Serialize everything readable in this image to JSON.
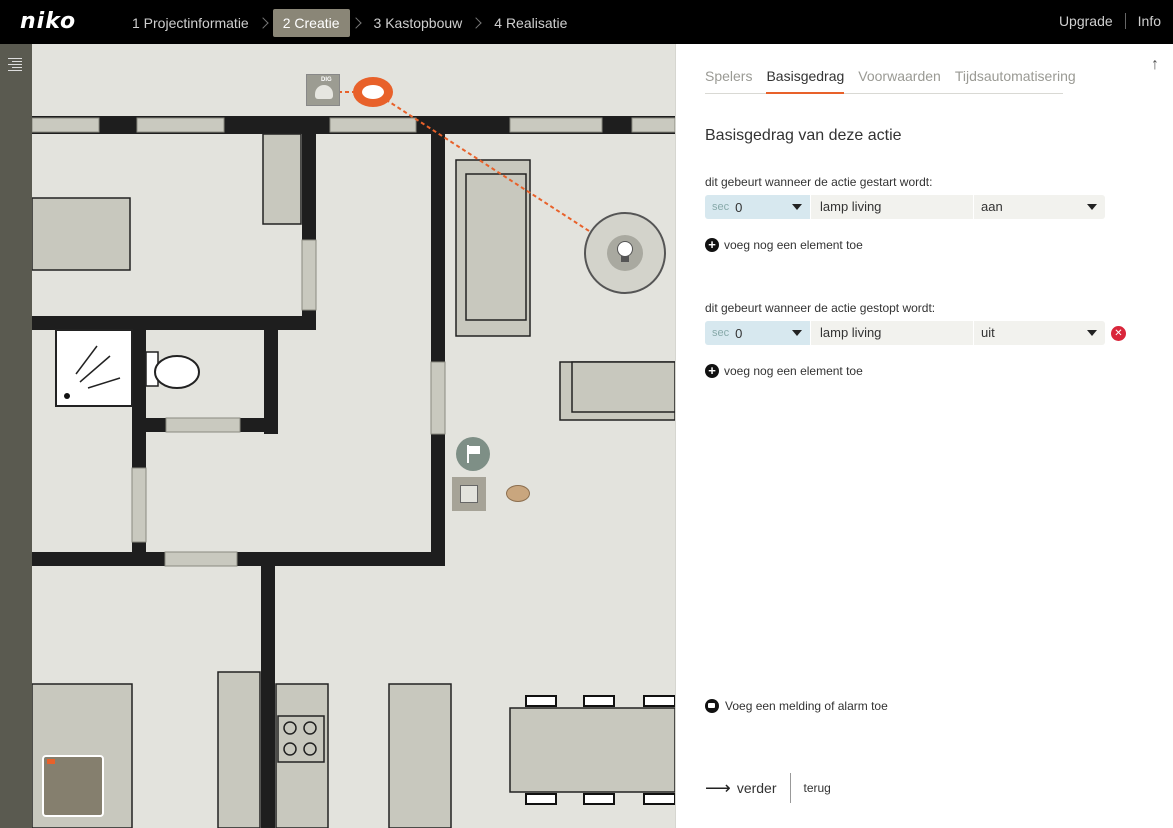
{
  "brand": {
    "logo": "niko"
  },
  "steps": [
    {
      "label": "1 Projectinformatie",
      "active": false
    },
    {
      "label": "2 Creatie",
      "active": true
    },
    {
      "label": "3 Kastopbouw",
      "active": false
    },
    {
      "label": "4 Realisatie",
      "active": false
    }
  ],
  "top_links": {
    "upgrade": "Upgrade",
    "info": "Info"
  },
  "floorplan": {
    "device_label": "DIG"
  },
  "panel": {
    "tabs": [
      "Spelers",
      "Basisgedrag",
      "Voorwaarden",
      "Tijdsautomatisering"
    ],
    "active_tab": "Basisgedrag",
    "section_title": "Basisgedrag van deze actie",
    "start": {
      "label": "dit gebeurt wanneer de actie gestart wordt:",
      "unit": "sec",
      "delay": "0",
      "element": "lamp living",
      "state": "aan",
      "add_label": "voeg nog een element toe"
    },
    "stop": {
      "label": "dit gebeurt wanneer de actie gestopt wordt:",
      "unit": "sec",
      "delay": "0",
      "element": "lamp living",
      "state": "uit",
      "add_label": "voeg nog een element toe"
    },
    "alarm_label": "Voeg een melding of alarm toe",
    "footer": {
      "next": "verder",
      "back": "terug"
    }
  },
  "colors": {
    "accent": "#e8612a",
    "active_step": "#8a8677",
    "delete": "#d9263b",
    "delay_field": "#d7e8ef"
  }
}
